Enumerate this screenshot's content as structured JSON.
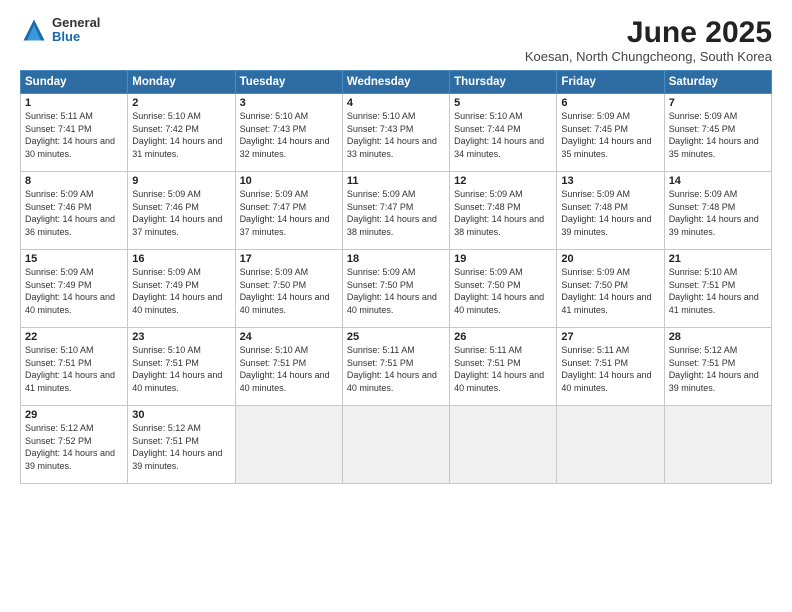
{
  "header": {
    "logo": {
      "general": "General",
      "blue": "Blue"
    },
    "title": "June 2025",
    "subtitle": "Koesan, North Chungcheong, South Korea"
  },
  "calendar": {
    "headers": [
      "Sunday",
      "Monday",
      "Tuesday",
      "Wednesday",
      "Thursday",
      "Friday",
      "Saturday"
    ],
    "weeks": [
      [
        null,
        null,
        null,
        null,
        {
          "day": "1",
          "sunrise": "5:11 AM",
          "sunset": "7:41 PM",
          "daylight": "14 hours and 30 minutes."
        },
        {
          "day": "2",
          "sunrise": "5:10 AM",
          "sunset": "7:42 PM",
          "daylight": "14 hours and 31 minutes."
        },
        {
          "day": "3",
          "sunrise": "5:10 AM",
          "sunset": "7:43 PM",
          "daylight": "14 hours and 32 minutes."
        },
        {
          "day": "4",
          "sunrise": "5:10 AM",
          "sunset": "7:43 PM",
          "daylight": "14 hours and 33 minutes."
        },
        {
          "day": "5",
          "sunrise": "5:10 AM",
          "sunset": "7:44 PM",
          "daylight": "14 hours and 34 minutes."
        },
        {
          "day": "6",
          "sunrise": "5:09 AM",
          "sunset": "7:45 PM",
          "daylight": "14 hours and 35 minutes."
        },
        {
          "day": "7",
          "sunrise": "5:09 AM",
          "sunset": "7:45 PM",
          "daylight": "14 hours and 35 minutes."
        }
      ],
      [
        {
          "day": "8",
          "sunrise": "5:09 AM",
          "sunset": "7:46 PM",
          "daylight": "14 hours and 36 minutes."
        },
        {
          "day": "9",
          "sunrise": "5:09 AM",
          "sunset": "7:46 PM",
          "daylight": "14 hours and 37 minutes."
        },
        {
          "day": "10",
          "sunrise": "5:09 AM",
          "sunset": "7:47 PM",
          "daylight": "14 hours and 37 minutes."
        },
        {
          "day": "11",
          "sunrise": "5:09 AM",
          "sunset": "7:47 PM",
          "daylight": "14 hours and 38 minutes."
        },
        {
          "day": "12",
          "sunrise": "5:09 AM",
          "sunset": "7:48 PM",
          "daylight": "14 hours and 38 minutes."
        },
        {
          "day": "13",
          "sunrise": "5:09 AM",
          "sunset": "7:48 PM",
          "daylight": "14 hours and 39 minutes."
        },
        {
          "day": "14",
          "sunrise": "5:09 AM",
          "sunset": "7:48 PM",
          "daylight": "14 hours and 39 minutes."
        }
      ],
      [
        {
          "day": "15",
          "sunrise": "5:09 AM",
          "sunset": "7:49 PM",
          "daylight": "14 hours and 40 minutes."
        },
        {
          "day": "16",
          "sunrise": "5:09 AM",
          "sunset": "7:49 PM",
          "daylight": "14 hours and 40 minutes."
        },
        {
          "day": "17",
          "sunrise": "5:09 AM",
          "sunset": "7:50 PM",
          "daylight": "14 hours and 40 minutes."
        },
        {
          "day": "18",
          "sunrise": "5:09 AM",
          "sunset": "7:50 PM",
          "daylight": "14 hours and 40 minutes."
        },
        {
          "day": "19",
          "sunrise": "5:09 AM",
          "sunset": "7:50 PM",
          "daylight": "14 hours and 40 minutes."
        },
        {
          "day": "20",
          "sunrise": "5:09 AM",
          "sunset": "7:50 PM",
          "daylight": "14 hours and 41 minutes."
        },
        {
          "day": "21",
          "sunrise": "5:10 AM",
          "sunset": "7:51 PM",
          "daylight": "14 hours and 41 minutes."
        }
      ],
      [
        {
          "day": "22",
          "sunrise": "5:10 AM",
          "sunset": "7:51 PM",
          "daylight": "14 hours and 41 minutes."
        },
        {
          "day": "23",
          "sunrise": "5:10 AM",
          "sunset": "7:51 PM",
          "daylight": "14 hours and 40 minutes."
        },
        {
          "day": "24",
          "sunrise": "5:10 AM",
          "sunset": "7:51 PM",
          "daylight": "14 hours and 40 minutes."
        },
        {
          "day": "25",
          "sunrise": "5:11 AM",
          "sunset": "7:51 PM",
          "daylight": "14 hours and 40 minutes."
        },
        {
          "day": "26",
          "sunrise": "5:11 AM",
          "sunset": "7:51 PM",
          "daylight": "14 hours and 40 minutes."
        },
        {
          "day": "27",
          "sunrise": "5:11 AM",
          "sunset": "7:51 PM",
          "daylight": "14 hours and 40 minutes."
        },
        {
          "day": "28",
          "sunrise": "5:12 AM",
          "sunset": "7:51 PM",
          "daylight": "14 hours and 39 minutes."
        }
      ],
      [
        {
          "day": "29",
          "sunrise": "5:12 AM",
          "sunset": "7:52 PM",
          "daylight": "14 hours and 39 minutes."
        },
        {
          "day": "30",
          "sunrise": "5:12 AM",
          "sunset": "7:51 PM",
          "daylight": "14 hours and 39 minutes."
        },
        null,
        null,
        null,
        null,
        null
      ]
    ]
  }
}
